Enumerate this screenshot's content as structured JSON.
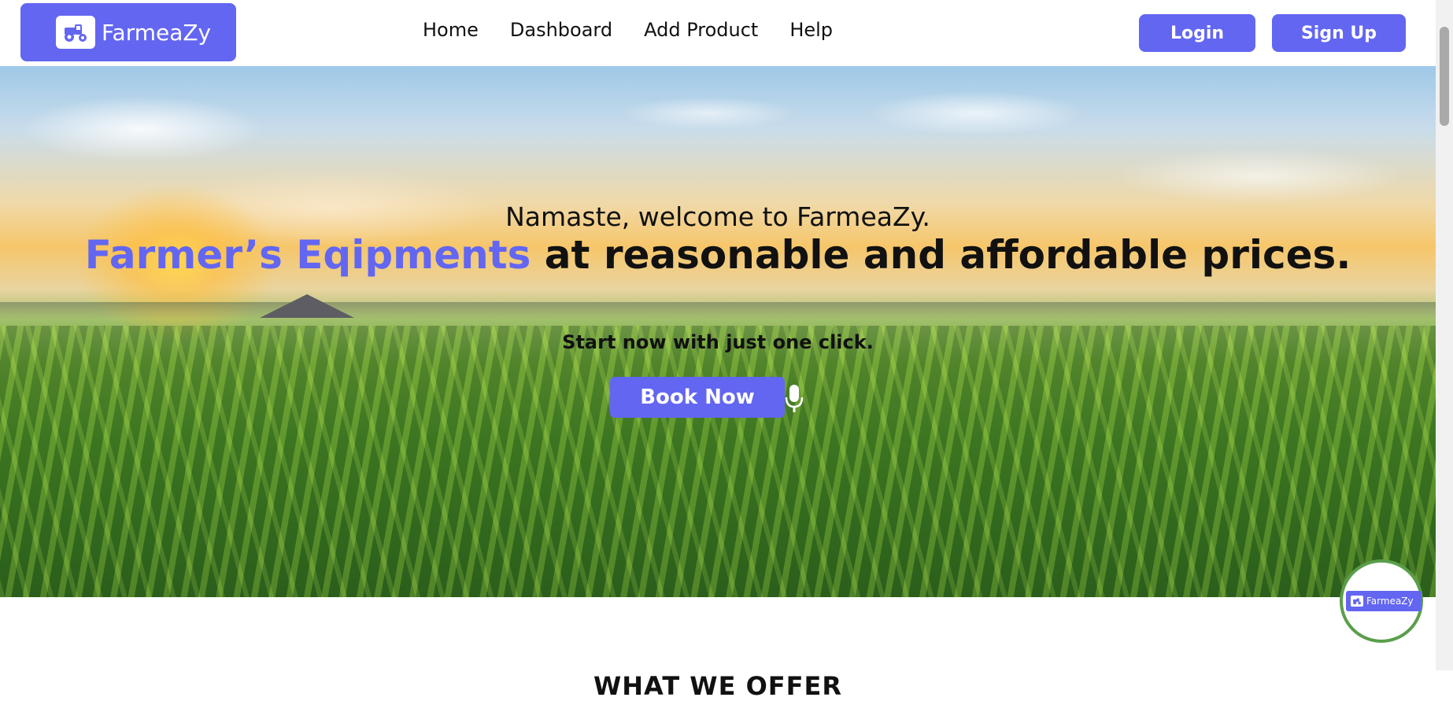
{
  "brand": {
    "name": "FarmeaZy",
    "icon": "tractor-icon",
    "color": "#6366f1"
  },
  "nav": {
    "links": [
      "Home",
      "Dashboard",
      "Add Product",
      "Help"
    ]
  },
  "auth": {
    "login_label": "Login",
    "signup_label": "Sign Up"
  },
  "hero": {
    "welcome": "Namaste, welcome to FarmeaZy.",
    "headline_accent": "Farmer’s Eqipments",
    "headline_rest": " at reasonable and affordable prices.",
    "subline": "Start now with just one click.",
    "cta_label": "Book Now",
    "mic_icon": "microphone-icon"
  },
  "offer": {
    "title": "WHAT WE OFFER"
  },
  "chat_widget": {
    "label": "FarmeaZy"
  }
}
